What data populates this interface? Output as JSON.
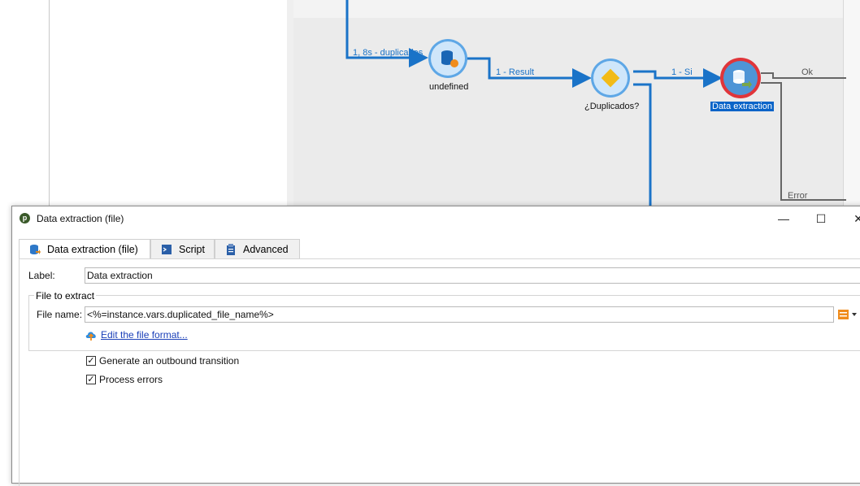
{
  "workflow": {
    "transitions": {
      "t1": "1, 8s - duplicados",
      "t2": "1 - Result",
      "t3": "1 - Si",
      "t4": "Ok",
      "t5": "Error"
    },
    "nodes": {
      "undefined_label": "undefined",
      "test_label": "¿Duplicados?",
      "extraction_label": "Data extraction"
    }
  },
  "dialog": {
    "title": "Data extraction (file)",
    "buttons": {
      "minimize": "—",
      "maximize": "☐",
      "close": "✕"
    },
    "tabs": [
      {
        "label": "Data extraction (file)",
        "icon": "database-export-icon"
      },
      {
        "label": "Script",
        "icon": "script-icon"
      },
      {
        "label": "Advanced",
        "icon": "clipboard-icon"
      }
    ],
    "label_caption": "Label:",
    "label_value": "Data extraction",
    "group_title": "File to extract",
    "file_name_caption": "File name:",
    "file_name_value": "<%=instance.vars.duplicated_file_name%>",
    "edit_format_link": "Edit the file format...",
    "checkboxes": [
      {
        "label": "Generate an outbound transition",
        "checked": true
      },
      {
        "label": "Process errors",
        "checked": true
      }
    ]
  },
  "colors": {
    "accent_blue": "#1a73c8",
    "selected_bg": "#0a64c8",
    "node_fill": "#cfe6fa",
    "node_border": "#5ea7e6",
    "selected_node_border": "#e0353a",
    "decision_fill": "#f2bb18"
  }
}
